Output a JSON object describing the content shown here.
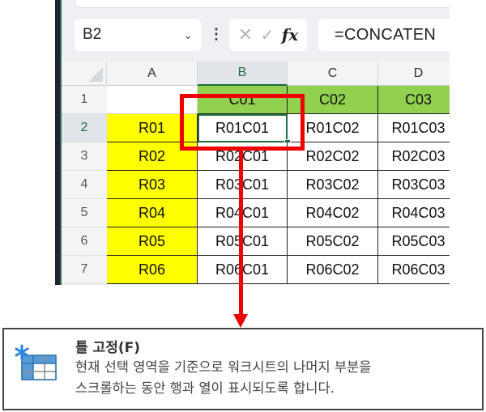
{
  "formula_bar": {
    "name_box": "B2",
    "cancel_symbol": "✕",
    "enter_symbol": "✓",
    "fx_label": "fx",
    "formula": "=CONCATEN"
  },
  "sheet": {
    "columns": [
      "A",
      "B",
      "C",
      "D"
    ],
    "selected_column": "B",
    "rows": [
      {
        "num": "1",
        "cells": [
          "",
          "C01",
          "C02",
          "C03"
        ]
      },
      {
        "num": "2",
        "cells": [
          "R01",
          "R01C01",
          "R01C02",
          "R01C03"
        ]
      },
      {
        "num": "3",
        "cells": [
          "R02",
          "R02C01",
          "R02C02",
          "R02C03"
        ]
      },
      {
        "num": "4",
        "cells": [
          "R03",
          "R03C01",
          "R03C02",
          "R03C03"
        ]
      },
      {
        "num": "5",
        "cells": [
          "R04",
          "R04C01",
          "R04C02",
          "R04C03"
        ]
      },
      {
        "num": "6",
        "cells": [
          "R05",
          "R05C01",
          "R05C02",
          "R05C03"
        ]
      },
      {
        "num": "7",
        "cells": [
          "R06",
          "R06C01",
          "R06C02",
          "R06C03"
        ]
      }
    ],
    "active_cell": "B2",
    "header_fill": "#92d050",
    "row_label_fill": "#ffff00"
  },
  "annotation": {
    "highlight_color": "#ee0000"
  },
  "tooltip": {
    "icon": "freeze-panes-icon",
    "title": "틀 고정(F)",
    "description_line1": "현재 선택 영역을 기준으로 워크시트의 나머지 부분을",
    "description_line2": "스크롤하는 동안 행과 열이 표시되도록 합니다."
  }
}
